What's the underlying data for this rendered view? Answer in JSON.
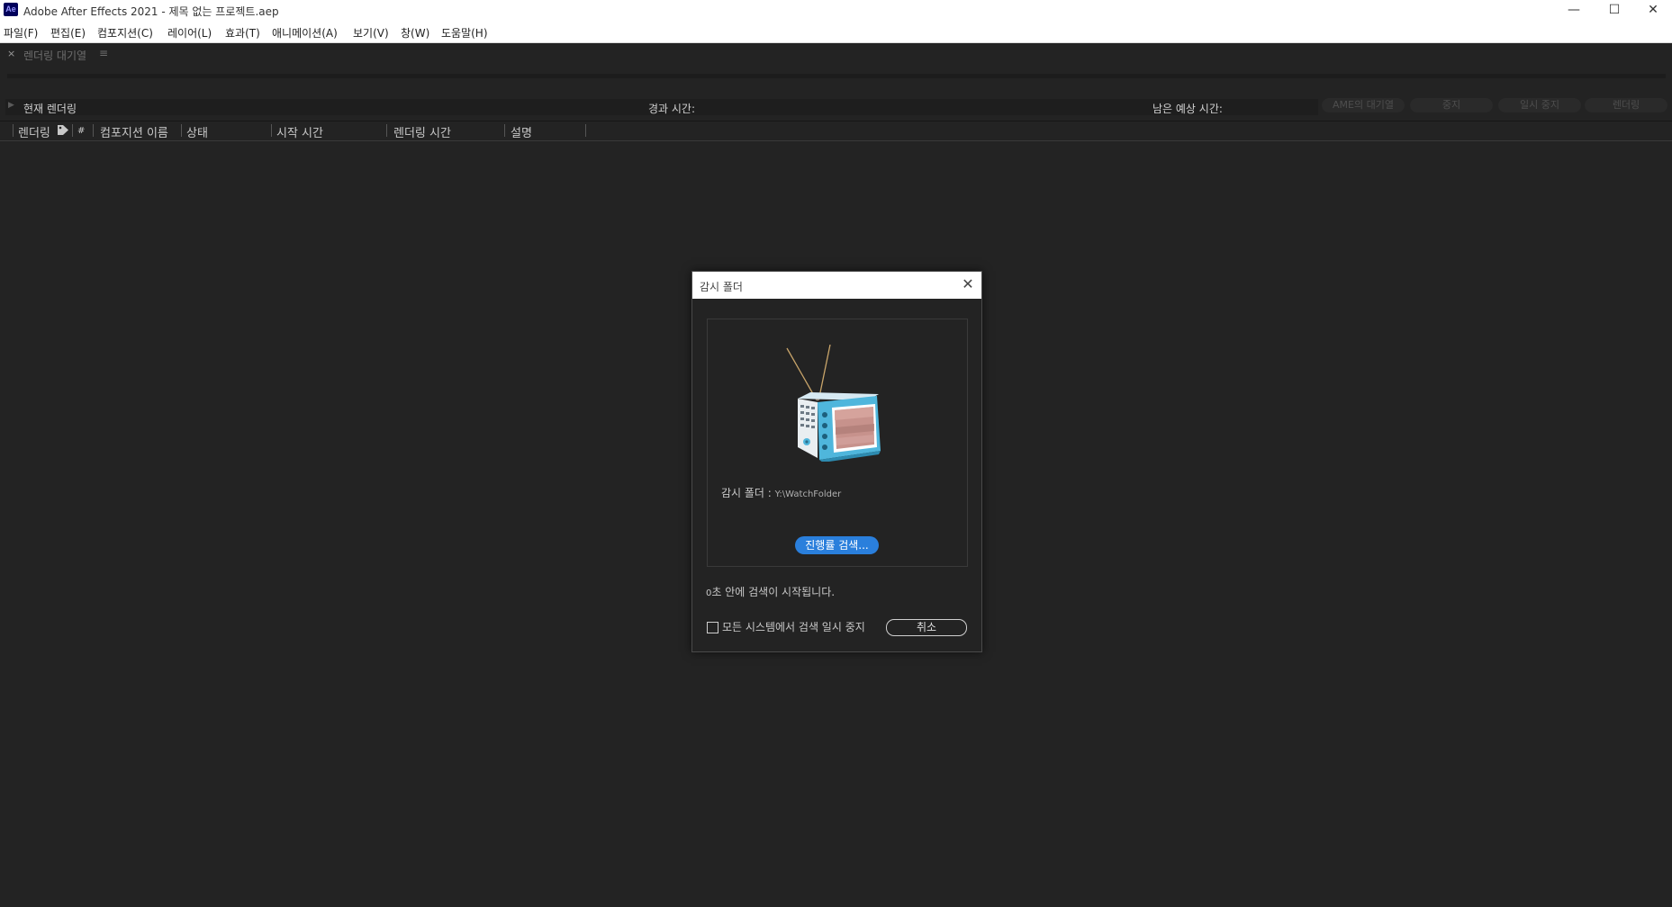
{
  "window": {
    "app_icon": "Ae",
    "title": "Adobe After Effects 2021 - 제목 없는 프로젝트.aep",
    "controls": {
      "minimize": "—",
      "maximize": "☐",
      "close": "✕"
    }
  },
  "menu": [
    "파일(F)",
    "편집(E)",
    "컴포지션(C)",
    "레이어(L)",
    "효과(T)",
    "애니메이션(A)",
    "보기(V)",
    "창(W)",
    "도움말(H)"
  ],
  "panel": {
    "close_glyph": "×",
    "title": "렌더링 대기열",
    "menu_glyph": "≡"
  },
  "status": {
    "current_render": "현재 렌더링",
    "elapsed": "경과 시간:",
    "remaining": "남은 예상 시간:",
    "buttons": {
      "ame_queue": "AME의 대기열",
      "stop": "중지",
      "pause": "일시 중지",
      "render": "렌더링"
    }
  },
  "columns": {
    "render": "렌더링",
    "label_icon": "tag-icon",
    "number": "#",
    "comp_name": "컴포지션 이름",
    "status": "상태",
    "start_time": "시작 시간",
    "render_time": "렌더링 시간",
    "comment": "설명"
  },
  "dialog": {
    "title": "감시 폴더",
    "close_glyph": "✕",
    "illustration": "tv-icon",
    "folder_label": "감시 폴더 : ",
    "folder_path": "Y:\\WatchFolder",
    "search_button": "진행률 검색...",
    "countdown_num": "0",
    "countdown_text": "초 안에 검색이 시작됩니다.",
    "pause_all_label": "모든 시스템에서 검색 일시 중지",
    "pause_all_checked": false,
    "cancel_button": "취소"
  },
  "colors": {
    "background": "#232323",
    "accent": "#2a7fdc",
    "tv_body": "#4fb6dc"
  }
}
